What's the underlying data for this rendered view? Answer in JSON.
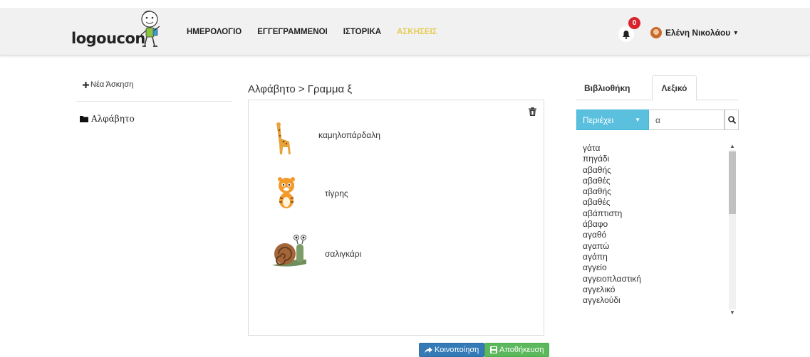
{
  "navbar": {
    "logo_text": "logoucon",
    "links": [
      "ΗΜΕΡΟΛΟΓΙΟ",
      "ΕΓΓΕΓΡΑΜΜΕΝΟΙ",
      "ΙΣΤΟΡΙΚΑ",
      "ΑΣΚΗΣΕΙΣ"
    ],
    "active_link": "ΑΣΚΗΣΕΙΣ",
    "notification_count": "0",
    "user_name": "Ελένη Νικολάου",
    "user_caret": "▾"
  },
  "sidebar": {
    "new_exercise_label": "Νέα Άσκηση",
    "folders": [
      {
        "label": "Αλφάβητο",
        "icon": "folder-icon"
      }
    ]
  },
  "main": {
    "breadcrumb": "Αλφάβητο > Γραμμα ξ",
    "words": [
      {
        "label": "καμηλοπάρδαλη",
        "icon": "giraffe-image"
      },
      {
        "label": "τίγρης",
        "icon": "tiger-image"
      },
      {
        "label": "σαλιγκάρι",
        "icon": "snail-image"
      }
    ],
    "share_label": "Κοινοποίηση",
    "save_label": "Αποθήκευση"
  },
  "right_panel": {
    "tabs": [
      "Βιβλιοθήκη",
      "Λεξικό"
    ],
    "active_tab": "Λεξικό",
    "filter_label": "Περιέχει",
    "search_value": "α",
    "dictionary_words": [
      "γάτα",
      "πηγάδι",
      "αβαθής",
      "αβαθές",
      "αβαθής",
      "αβαθές",
      "αβάπτιστη",
      "άβαφο",
      "αγαθό",
      "αγαπώ",
      "αγάπη",
      "αγγείο",
      "αγγειοπλαστική",
      "αγγελικό",
      "αγγελούδι"
    ]
  },
  "colors": {
    "active_nav": "#e6cc55",
    "info_button": "#5bc0de",
    "share_button": "#337ab7",
    "save_button": "#5cb85c",
    "badge": "#d9232d"
  }
}
